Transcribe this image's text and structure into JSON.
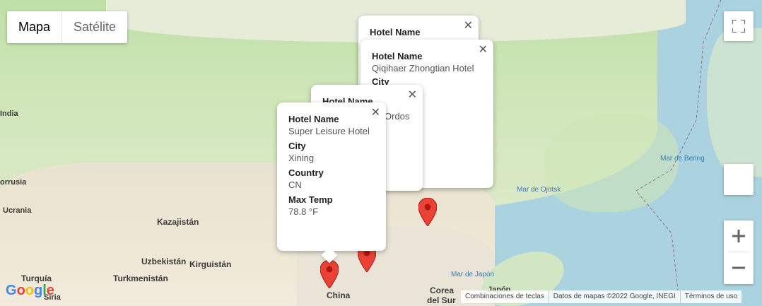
{
  "map_type": {
    "map_label": "Mapa",
    "satellite_label": "Satélite"
  },
  "labels": {
    "countries": [
      {
        "name": "India",
        "cls": "small"
      },
      {
        "name": "orrusia",
        "cls": "small"
      },
      {
        "name": "Ucrania",
        "cls": "small"
      },
      {
        "name": "Kazajistán",
        "cls": ""
      },
      {
        "name": "Uzbekistán",
        "cls": ""
      },
      {
        "name": "Kirguistán",
        "cls": ""
      },
      {
        "name": "Turquía",
        "cls": ""
      },
      {
        "name": "Turkmenistán",
        "cls": ""
      },
      {
        "name": "Siria",
        "cls": "small"
      },
      {
        "name": "China",
        "cls": ""
      },
      {
        "name": "Corea",
        "cls": ""
      },
      {
        "name": "del Sur",
        "cls": ""
      },
      {
        "name": "Japón",
        "cls": "small"
      }
    ],
    "seas": [
      "Mar de Bering",
      "Mar de Ojotsk",
      "Mar de Japón"
    ]
  },
  "popups": [
    {
      "hotel_label": "Hotel Name",
      "hotel": ""
    },
    {
      "hotel_label": "Hotel Name",
      "hotel": "Qiqihaer Zhongtian Hotel",
      "city_label": "City"
    },
    {
      "hotel_label": "Hotel Name",
      "partial_value": "Ordos"
    },
    {
      "hotel_label": "Hotel Name",
      "hotel": "Super Leisure Hotel",
      "city_label": "City",
      "city": "Xining",
      "country_label": "Country",
      "country": "CN",
      "temp_label": "Max Temp",
      "temp": "78.8 °F"
    }
  ],
  "attribution": {
    "shortcuts": "Combinaciones de teclas",
    "data": "Datos de mapas ©2022 Google, INEGI",
    "terms": "Términos de uso"
  },
  "logo": "Google",
  "colors": {
    "marker": "#ea4335",
    "water": "#aad3df"
  }
}
